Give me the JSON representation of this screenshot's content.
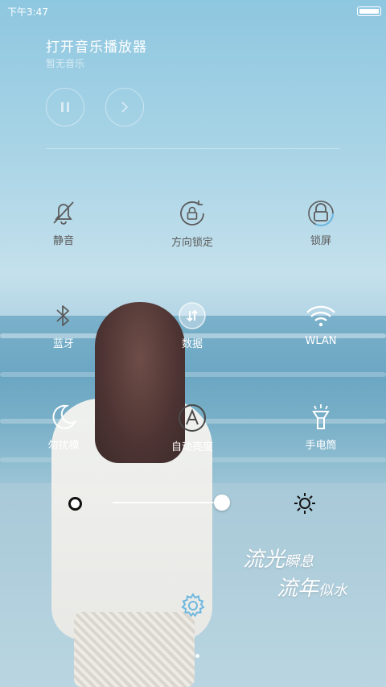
{
  "status_bar": {
    "time": "下午3:47"
  },
  "music": {
    "title": "打开音乐播放器",
    "subtitle": "暂无音乐"
  },
  "toggles": [
    {
      "label": "静音",
      "icon": "bell-off-icon"
    },
    {
      "label": "方向锁定",
      "icon": "rotation-lock-icon"
    },
    {
      "label": "锁屏",
      "icon": "lock-icon"
    },
    {
      "label": "蓝牙",
      "icon": "bluetooth-icon"
    },
    {
      "label": "数据",
      "icon": "mobile-data-icon"
    },
    {
      "label": "WLAN",
      "icon": "wifi-icon"
    },
    {
      "label": "勿扰模",
      "icon": "moon-icon"
    },
    {
      "label": "自动亮度",
      "icon": "auto-brightness-icon"
    },
    {
      "label": "手电筒",
      "icon": "flashlight-icon"
    }
  ],
  "brightness": {
    "level": 1.0
  },
  "wallpaper_text": {
    "line1_big": "流光",
    "line1_small": "瞬息",
    "line2_big": "流年",
    "line2_small": "似水"
  },
  "colors": {
    "accent": "#6fb8e0",
    "icon_dark": "#5b5b5b"
  }
}
